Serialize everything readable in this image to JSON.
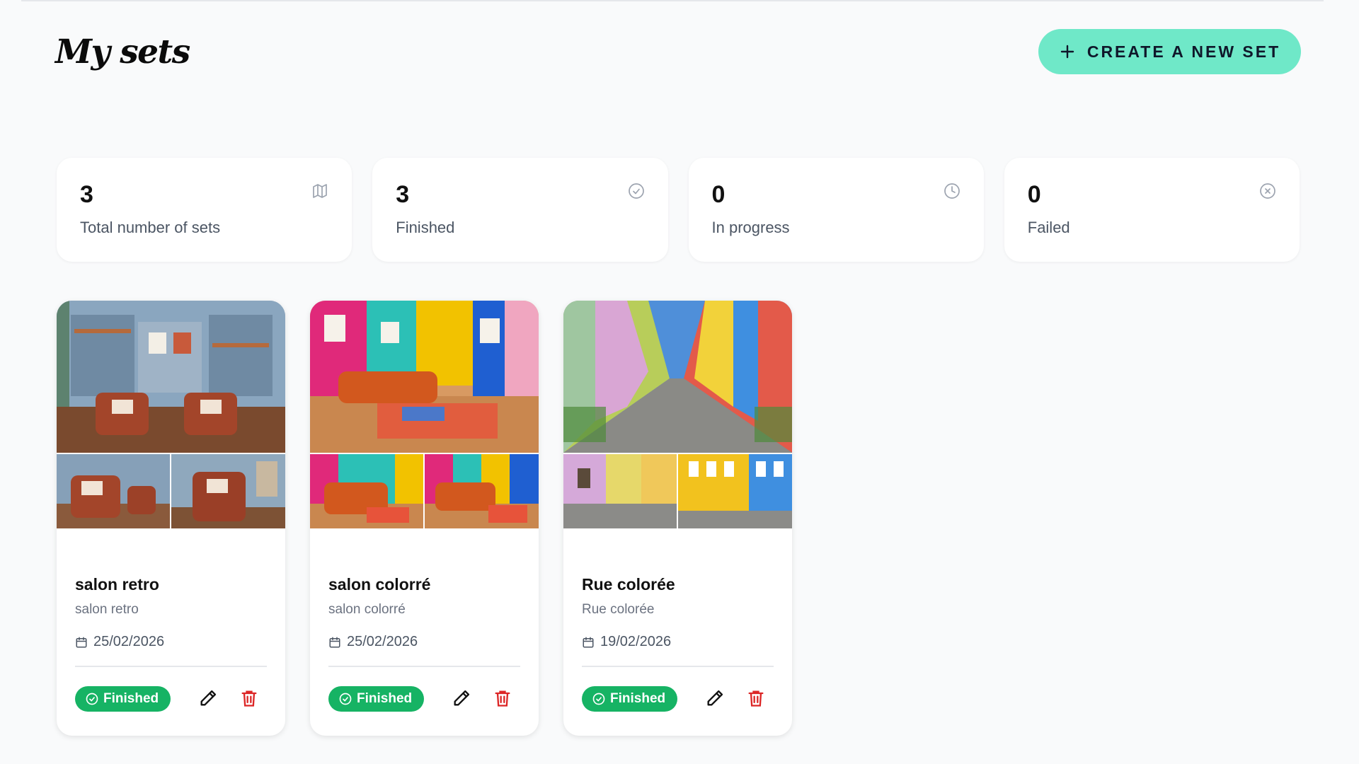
{
  "header": {
    "title": "My sets",
    "create_button": "CREATE A NEW SET",
    "create_icon": "plus-icon"
  },
  "stats": [
    {
      "value": "3",
      "label": "Total number of sets",
      "icon": "map-icon"
    },
    {
      "value": "3",
      "label": "Finished",
      "icon": "check-circle-icon"
    },
    {
      "value": "0",
      "label": "In progress",
      "icon": "clock-icon"
    },
    {
      "value": "0",
      "label": "Failed",
      "icon": "x-circle-icon"
    }
  ],
  "sets": [
    {
      "name": "salon retro",
      "description": "salon retro",
      "date": "25/02/2026",
      "status": "Finished"
    },
    {
      "name": "salon colorré",
      "description": "salon colorré",
      "date": "25/02/2026",
      "status": "Finished"
    },
    {
      "name": "Rue colorée",
      "description": "Rue colorée",
      "date": "19/02/2026",
      "status": "Finished"
    }
  ],
  "colors": {
    "accent": "#6fe8c8",
    "status_finished": "#16b364",
    "delete": "#dc2626",
    "background": "#f9fafb"
  }
}
